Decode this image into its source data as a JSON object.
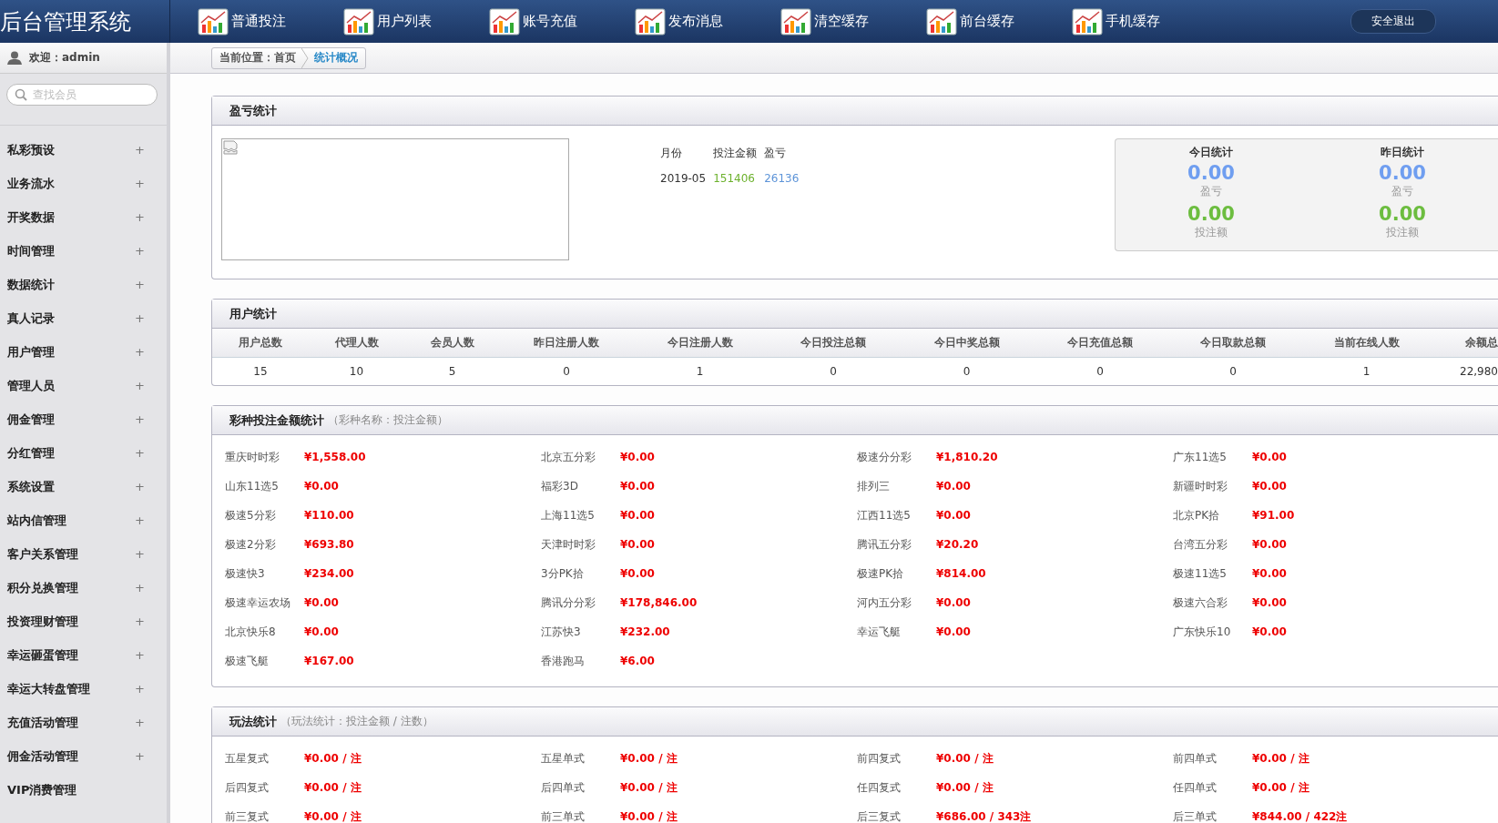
{
  "header": {
    "title": "后台管理系统",
    "nav": [
      {
        "label": "普通投注"
      },
      {
        "label": "用户列表"
      },
      {
        "label": "账号充值"
      },
      {
        "label": "发布消息"
      },
      {
        "label": "清空缓存"
      },
      {
        "label": "前台缓存"
      },
      {
        "label": "手机缓存"
      }
    ],
    "logout": "安全退出"
  },
  "sidebar": {
    "welcome": "欢迎：admin",
    "search": {
      "placeholder": "查找会员"
    },
    "items": [
      {
        "label": "私彩预设",
        "expander": "+"
      },
      {
        "label": "业务流水",
        "expander": "+"
      },
      {
        "label": "开奖数据",
        "expander": "+"
      },
      {
        "label": "时间管理",
        "expander": "+"
      },
      {
        "label": "数据统计",
        "expander": "+"
      },
      {
        "label": "真人记录",
        "expander": "+"
      },
      {
        "label": "用户管理",
        "expander": "+"
      },
      {
        "label": "管理人员",
        "expander": "+"
      },
      {
        "label": "佣金管理",
        "expander": "+"
      },
      {
        "label": "分红管理",
        "expander": "+"
      },
      {
        "label": "系统设置",
        "expander": "+"
      },
      {
        "label": "站内信管理",
        "expander": "+"
      },
      {
        "label": "客户关系管理",
        "expander": "+"
      },
      {
        "label": "积分兑换管理",
        "expander": "+"
      },
      {
        "label": "投资理财管理",
        "expander": "+"
      },
      {
        "label": "幸运砸蛋管理",
        "expander": "+"
      },
      {
        "label": "幸运大转盘管理",
        "expander": "+"
      },
      {
        "label": "充值活动管理",
        "expander": "+"
      },
      {
        "label": "佣金活动管理",
        "expander": "+"
      },
      {
        "label": "VIP消费管理"
      }
    ]
  },
  "breadcrumb": {
    "prefix": "当前位置：",
    "items": [
      {
        "label": "首页",
        "selected": false
      },
      {
        "label": "统计概况",
        "selected": true
      }
    ]
  },
  "panels": [
    {
      "kind": "profit",
      "title": "盈亏统计",
      "table": {
        "columns": [
          "月份",
          "投注金额",
          "盈亏"
        ],
        "rows": [
          [
            "2019-05",
            "151406",
            "26136"
          ]
        ]
      },
      "summary": [
        {
          "title": "今日统计",
          "profit": "0.00",
          "profit_label": "盈亏",
          "bet": "0.00",
          "bet_label": "投注额"
        },
        {
          "title": "昨日统计",
          "profit": "0.00",
          "profit_label": "盈亏",
          "bet": "0.00",
          "bet_label": "投注额"
        }
      ]
    },
    {
      "kind": "users",
      "title": "用户统计",
      "columns": [
        "用户总数",
        "代理人数",
        "会员人数",
        "昨日注册人数",
        "今日注册人数",
        "今日投注总额",
        "今日中奖总额",
        "今日充值总额",
        "今日取款总额",
        "当前在线人数",
        "余额总"
      ],
      "values": [
        "15",
        "10",
        "5",
        "0",
        "1",
        "0",
        "0",
        "0",
        "0",
        "1",
        "22,980"
      ]
    },
    {
      "kind": "amounts",
      "title": "彩种投注金额统计",
      "note": "（彩种名称：投注金额）",
      "items": [
        {
          "name": "重庆时时彩",
          "amount": "¥1,558.00"
        },
        {
          "name": "北京五分彩",
          "amount": "¥0.00"
        },
        {
          "name": "极速分分彩",
          "amount": "¥1,810.20"
        },
        {
          "name": "广东11选5",
          "amount": "¥0.00"
        },
        {
          "name": "山东11选5",
          "amount": "¥0.00"
        },
        {
          "name": "福彩3D",
          "amount": "¥0.00"
        },
        {
          "name": "排列三",
          "amount": "¥0.00"
        },
        {
          "name": "新疆时时彩",
          "amount": "¥0.00"
        },
        {
          "name": "极速5分彩",
          "amount": "¥110.00"
        },
        {
          "name": "上海11选5",
          "amount": "¥0.00"
        },
        {
          "name": "江西11选5",
          "amount": "¥0.00"
        },
        {
          "name": "北京PK拾",
          "amount": "¥91.00"
        },
        {
          "name": "极速2分彩",
          "amount": "¥693.80"
        },
        {
          "name": "天津时时彩",
          "amount": "¥0.00"
        },
        {
          "name": "腾讯五分彩",
          "amount": "¥20.20"
        },
        {
          "name": "台湾五分彩",
          "amount": "¥0.00"
        },
        {
          "name": "极速快3",
          "amount": "¥234.00"
        },
        {
          "name": "3分PK拾",
          "amount": "¥0.00"
        },
        {
          "name": "极速PK拾",
          "amount": "¥814.00"
        },
        {
          "name": "极速11选5",
          "amount": "¥0.00"
        },
        {
          "name": "极速幸运农场",
          "amount": "¥0.00"
        },
        {
          "name": "腾讯分分彩",
          "amount": "¥178,846.00"
        },
        {
          "name": "河内五分彩",
          "amount": "¥0.00"
        },
        {
          "name": "极速六合彩",
          "amount": "¥0.00"
        },
        {
          "name": "北京快乐8",
          "amount": "¥0.00"
        },
        {
          "name": "江苏快3",
          "amount": "¥232.00"
        },
        {
          "name": "幸运飞艇",
          "amount": "¥0.00"
        },
        {
          "name": "广东快乐10",
          "amount": "¥0.00"
        },
        {
          "name": "极速飞艇",
          "amount": "¥167.00"
        },
        {
          "name": "香港跑马",
          "amount": "¥6.00"
        }
      ]
    },
    {
      "kind": "amounts",
      "title": "玩法统计",
      "note": "（玩法统计：投注金额 / 注数）",
      "items": [
        {
          "name": "五星复式",
          "amount": "¥0.00 / 注"
        },
        {
          "name": "五星单式",
          "amount": "¥0.00 / 注"
        },
        {
          "name": "前四复式",
          "amount": "¥0.00 / 注"
        },
        {
          "name": "前四单式",
          "amount": "¥0.00 / 注"
        },
        {
          "name": "后四复式",
          "amount": "¥0.00 / 注"
        },
        {
          "name": "后四单式",
          "amount": "¥0.00 / 注"
        },
        {
          "name": "任四复式",
          "amount": "¥0.00 / 注"
        },
        {
          "name": "任四单式",
          "amount": "¥0.00 / 注"
        },
        {
          "name": "前三复式",
          "amount": "¥0.00 / 注"
        },
        {
          "name": "前三单式",
          "amount": "¥0.00 / 注"
        },
        {
          "name": "后三复式",
          "amount": "¥686.00 / 343注"
        },
        {
          "name": "后三单式",
          "amount": "¥844.00 / 422注"
        }
      ]
    }
  ]
}
